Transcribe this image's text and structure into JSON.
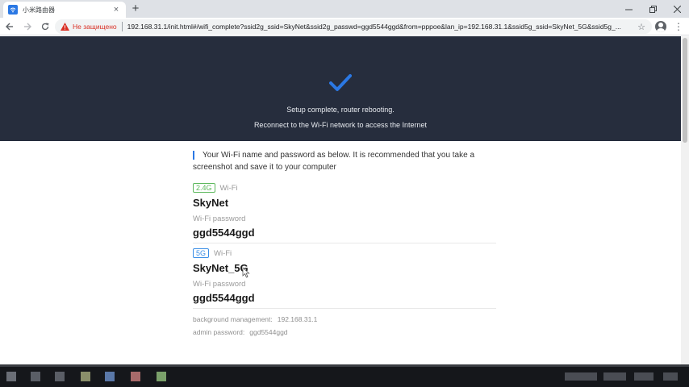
{
  "browser": {
    "tab_title": "小米路由器",
    "tab_close": "×",
    "new_tab": "+",
    "security_label": "Не защищено",
    "url": "192.168.31.1/init.html#/wifi_complete?ssid2g_ssid=SkyNet&ssid2g_passwd=ggd5544ggd&from=pppoe&lan_ip=192.168.31.1&ssid5g_ssid=SkyNet_5G&ssid5g_..."
  },
  "banner": {
    "line1": "Setup complete, router rebooting.",
    "line2": "Reconnect to the Wi-Fi network to access the Internet",
    "accent": "#2b78e4"
  },
  "info": {
    "intro_line1": "Your Wi-Fi name and password as below. It is recommended that you take a",
    "intro_line2": "screenshot and save it to your computer"
  },
  "wifi_24": {
    "band": "2.4G",
    "label": "Wi-Fi",
    "ssid": "SkyNet",
    "password_label": "Wi-Fi password",
    "password": "ggd5544ggd",
    "tag_color": "#5cb85c"
  },
  "wifi_5": {
    "band": "5G",
    "label": "Wi-Fi",
    "ssid": "SkyNet_5G",
    "password_label": "Wi-Fi password",
    "password": "ggd5544ggd",
    "tag_color": "#3a8ee6"
  },
  "management": {
    "bg_label": "background management:",
    "bg_value": "192.168.31.1",
    "admin_label": "admin password:",
    "admin_value": "ggd5544ggd"
  }
}
